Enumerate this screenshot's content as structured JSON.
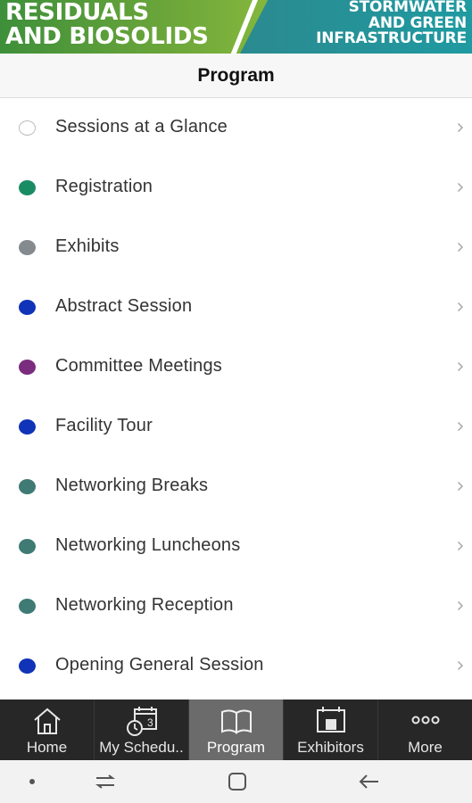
{
  "banner": {
    "left_line1": "RESIDUALS",
    "left_line2": "AND BIOSOLIDS",
    "right_line1": "STORMWATER",
    "right_line2": "AND GREEN",
    "right_line3": "INFRASTRUCTURE"
  },
  "header": {
    "title": "Program"
  },
  "program_items": [
    {
      "label": "Sessions at a Glance",
      "color": "hollow"
    },
    {
      "label": "Registration",
      "color": "#1a8c63"
    },
    {
      "label": "Exhibits",
      "color": "#858a8f"
    },
    {
      "label": "Abstract Session",
      "color": "#1133b8"
    },
    {
      "label": "Committee Meetings",
      "color": "#7a2d7e"
    },
    {
      "label": "Facility Tour",
      "color": "#1133b8"
    },
    {
      "label": "Networking Breaks",
      "color": "#3f7a74"
    },
    {
      "label": "Networking Luncheons",
      "color": "#3f7a74"
    },
    {
      "label": "Networking Reception",
      "color": "#3f7a74"
    },
    {
      "label": "Opening General Session",
      "color": "#1133b8"
    }
  ],
  "tabs": [
    {
      "label": "Home",
      "icon": "home-icon"
    },
    {
      "label": "My Schedu..",
      "icon": "calendar-clock-icon"
    },
    {
      "label": "Program",
      "icon": "book-icon",
      "active": true
    },
    {
      "label": "Exhibitors",
      "icon": "exhibitor-booth-icon"
    },
    {
      "label": "More",
      "icon": "more-dots-icon"
    }
  ],
  "calendar_icon_number": "3",
  "system_nav": [
    "dot-icon",
    "recents-icon",
    "home-square-icon",
    "back-arrow-icon"
  ]
}
